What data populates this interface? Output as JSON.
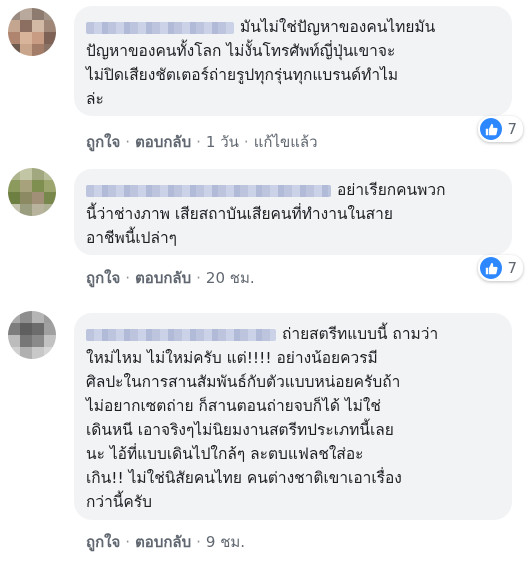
{
  "comments": [
    {
      "lines": [
        "มันไม่ใช่ปัญหาของคนไทยมัน",
        "ปัญหาของคนทั้งโลก ไม่งั้นโทรศัพท์ญี่ปุ่นเขาจะ",
        "ไม่ปิดเสียงชัตเตอร์ถ่ายรูปทุกรุ่นทุกแบรนด์ทำไม",
        "ล่ะ"
      ],
      "actions": {
        "like": "ถูกใจ",
        "reply": "ตอบกลับ",
        "time": "1 วัน",
        "edited": "แก้ไขแล้ว"
      },
      "reaction_count": "7"
    },
    {
      "lines": [
        "อย่าเรียกคนพวก",
        "นี้ว่าช่างภาพ เสียสถาบันเสียคนที่ทำงานในสาย",
        "อาชีพนี้เปล่าๆ"
      ],
      "actions": {
        "like": "ถูกใจ",
        "reply": "ตอบกลับ",
        "time": "20 ชม."
      },
      "reaction_count": "7"
    },
    {
      "lines": [
        "ถ่ายสตรีทแบบนี้ ถามว่า",
        "ใหม่ไหม ไม่ใหม่ครับ แต่!!!! อย่างน้อยควรมี",
        "ศิลปะในการสานสัมพันธ์กับตัวแบบหน่อยครับถ้า",
        "ไม่อยากเซตถ่าย ก็สานตอนถ่ายจบก็ได้ ไม่ใช่",
        "เดินหนี เอาจริงๆไม่นิยมงานสตรีทประเภทนี้เลย",
        "นะ ไอ้ที่แบบเดินไปใกล้ๆ ละตบแฟลชใส่อะ",
        "เกิน!! ไม่ใช่นิสัยคนไทย คนต่างชาติเขาเอาเรื่อง",
        "กว่านี้ครับ"
      ],
      "actions": {
        "like": "ถูกใจ",
        "reply": "ตอบกลับ",
        "time": "9 ชม."
      }
    }
  ],
  "colors": {
    "bubble_bg": "#f2f3f5",
    "like_blue": "#2d88ff",
    "meta_gray": "#606770"
  },
  "icons": [
    "like-icon"
  ]
}
